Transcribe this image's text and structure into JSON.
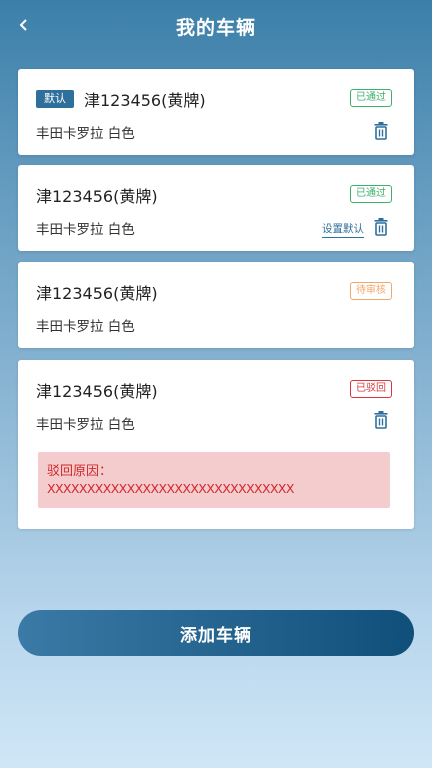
{
  "header": {
    "back_icon": "chevron-left-icon",
    "title": "我的车辆"
  },
  "vehicles": [
    {
      "default_tag": "默认",
      "plate": "津123456(黄牌)",
      "model": "丰田卡罗拉  白色",
      "status": "已通过",
      "status_color": "#3fb06a"
    },
    {
      "plate": "津123456(黄牌)",
      "model": "丰田卡罗拉  白色",
      "status": "已通过",
      "status_color": "#3fb06a",
      "set_default_label": "设置默认"
    },
    {
      "plate": "津123456(黄牌)",
      "model": "丰田卡罗拉  白色",
      "status": "待审核",
      "status_color": "#f2a76b"
    },
    {
      "plate": "津123456(黄牌)",
      "model": "丰田卡罗拉  白色",
      "status": "已驳回",
      "status_color": "#d9363b",
      "reject_label": "驳回原因：",
      "reject_reason": "XXXXXXXXXXXXXXXXXXXXXXXXXXXXXXX"
    }
  ],
  "add_button": "添加车辆",
  "colors": {
    "accent": "#2f6f9c",
    "reject_bg": "#f5cccd",
    "reject_text": "#d0282b"
  }
}
